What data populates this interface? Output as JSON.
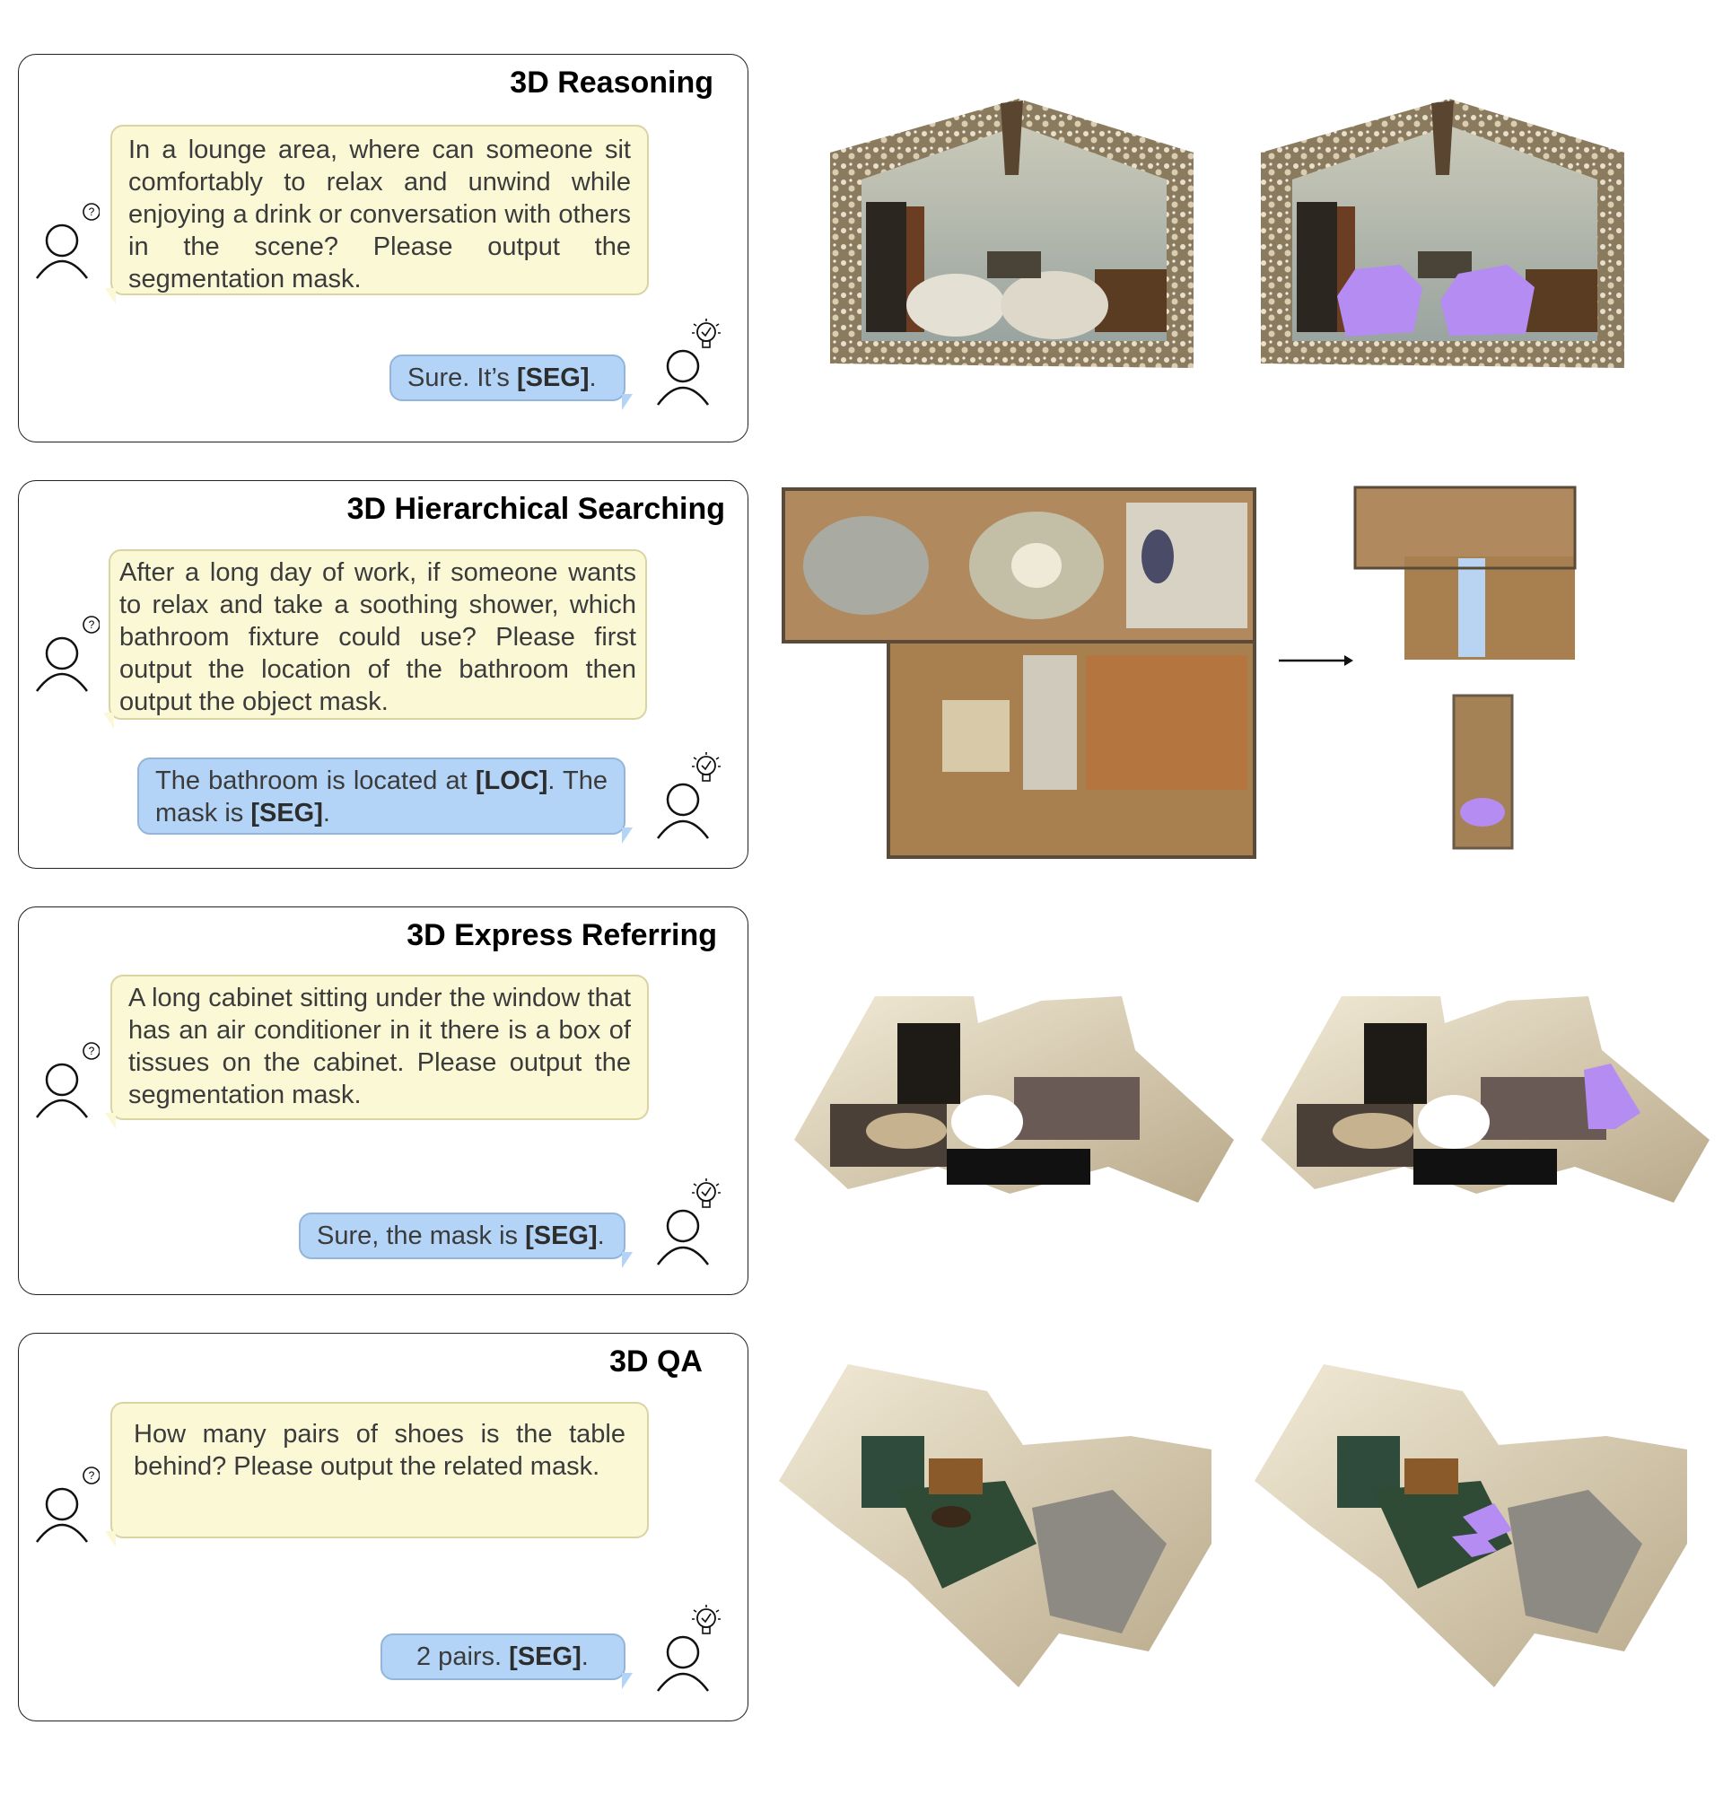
{
  "panels": [
    {
      "title": "3D Reasoning",
      "question": "In a lounge area, where can someone sit comfortably to relax and unwind while enjoying a drink or conversation with others in the scene? Please output the segmentation mask.",
      "answer_pre": "Sure. It’s ",
      "answer_token": "[SEG]",
      "answer_post": "."
    },
    {
      "title": "3D Hierarchical Searching",
      "question": "After a long day of work, if someone wants to relax and take a soothing shower, which bathroom fixture could use? Please first output the location of the bathroom then output the object  mask.",
      "answer_pre": "The bathroom is located at ",
      "answer_token": "[LOC]",
      "answer_mid": ". The mask is ",
      "answer_token2": "[SEG]",
      "answer_post": "."
    },
    {
      "title": "3D Express Referring",
      "question": "A long cabinet sitting under the window that has an air conditioner in it  there is a box of tissues on the cabinet. Please output the segmentation mask.",
      "answer_pre": "Sure, the mask is ",
      "answer_token": "[SEG]",
      "answer_post": "."
    },
    {
      "title": "3D QA",
      "question": "How many pairs of shoes is the table behind? Please output the related mask.",
      "answer_pre": "2 pairs.  ",
      "answer_token": "[SEG]",
      "answer_post": "."
    }
  ],
  "icons": {
    "user": "user-question-icon",
    "assistant": "assistant-lightbulb-icon",
    "question_mark": "?"
  },
  "colors": {
    "question_bubble": "#fbf8d6",
    "answer_bubble": "#b3d4f6",
    "mask": "#b48cf2"
  }
}
